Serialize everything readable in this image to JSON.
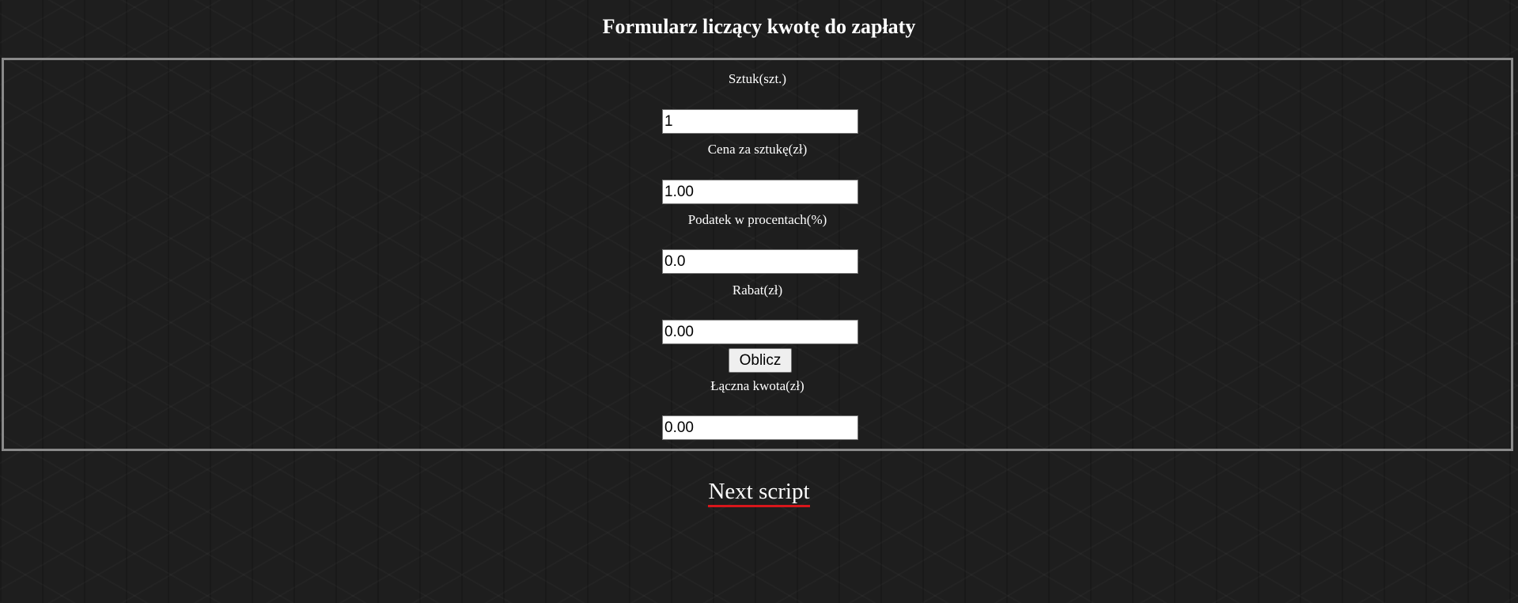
{
  "page": {
    "title": "Formularz liczący kwotę do zapłaty"
  },
  "form": {
    "quantity": {
      "label": "Sztuk(szt.)",
      "value": "1"
    },
    "unit_price": {
      "label": "Cena za sztukę(zł)",
      "value": "1.00"
    },
    "tax": {
      "label": "Podatek w procentach(%)",
      "value": "0.0"
    },
    "discount": {
      "label": "Rabat(zł)",
      "value": "0.00"
    },
    "calculate_button": "Oblicz",
    "total": {
      "label": "Łączna kwota(zł)",
      "value": "0.00"
    }
  },
  "footer": {
    "next_link": "Next script"
  },
  "colors": {
    "background": "#1e1e1e",
    "border": "#8a8a8a",
    "link_underline": "#d8161b"
  }
}
